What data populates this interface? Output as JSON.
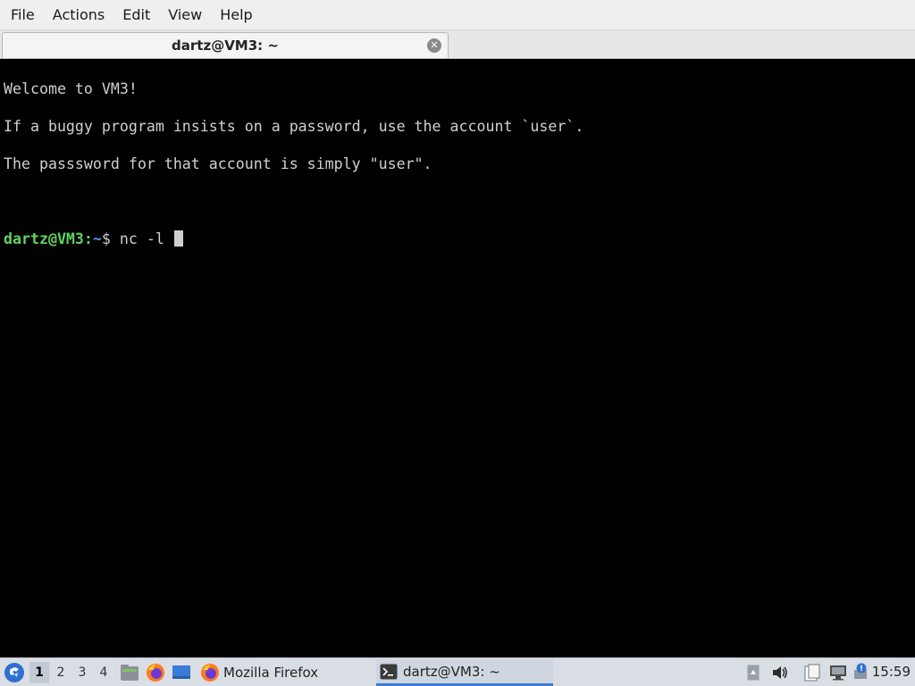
{
  "menubar": {
    "items": [
      "File",
      "Actions",
      "Edit",
      "View",
      "Help"
    ]
  },
  "tab": {
    "title": "dartz@VM3: ~",
    "close_icon": "close-icon"
  },
  "terminal": {
    "lines": [
      "Welcome to VM3!",
      "If a buggy program insists on a password, use the account `user`.",
      "The passsword for that account is simply \"user\"."
    ],
    "prompt_user": "dartz@VM3",
    "prompt_sep": ":",
    "prompt_path": "~",
    "prompt_symbol": "$ ",
    "command": "nc -l "
  },
  "taskbar": {
    "start_icon": "start-menu-icon",
    "workspaces": [
      "1",
      "2",
      "3",
      "4"
    ],
    "active_workspace": "1",
    "launchers": [
      "file-manager-icon",
      "firefox-icon",
      "desktop-icon"
    ],
    "tasks": [
      {
        "label": "Mozilla Firefox",
        "icon": "firefox-icon",
        "active": false
      },
      {
        "label": "dartz@VM3: ~",
        "icon": "terminal-icon",
        "active": true
      }
    ],
    "tray": [
      "notes-icon",
      "volume-icon",
      "clipboard-icon",
      "network-icon",
      "update-notification-icon"
    ],
    "clock": "15:59"
  },
  "colors": {
    "prompt_user": "#5fd35f",
    "prompt_path": "#5c8ff0",
    "terminal_bg": "#000000",
    "terminal_fg": "#d0d0d0",
    "taskbar_bg": "#d9dee5",
    "active_task_accent": "#3a7bd5"
  }
}
